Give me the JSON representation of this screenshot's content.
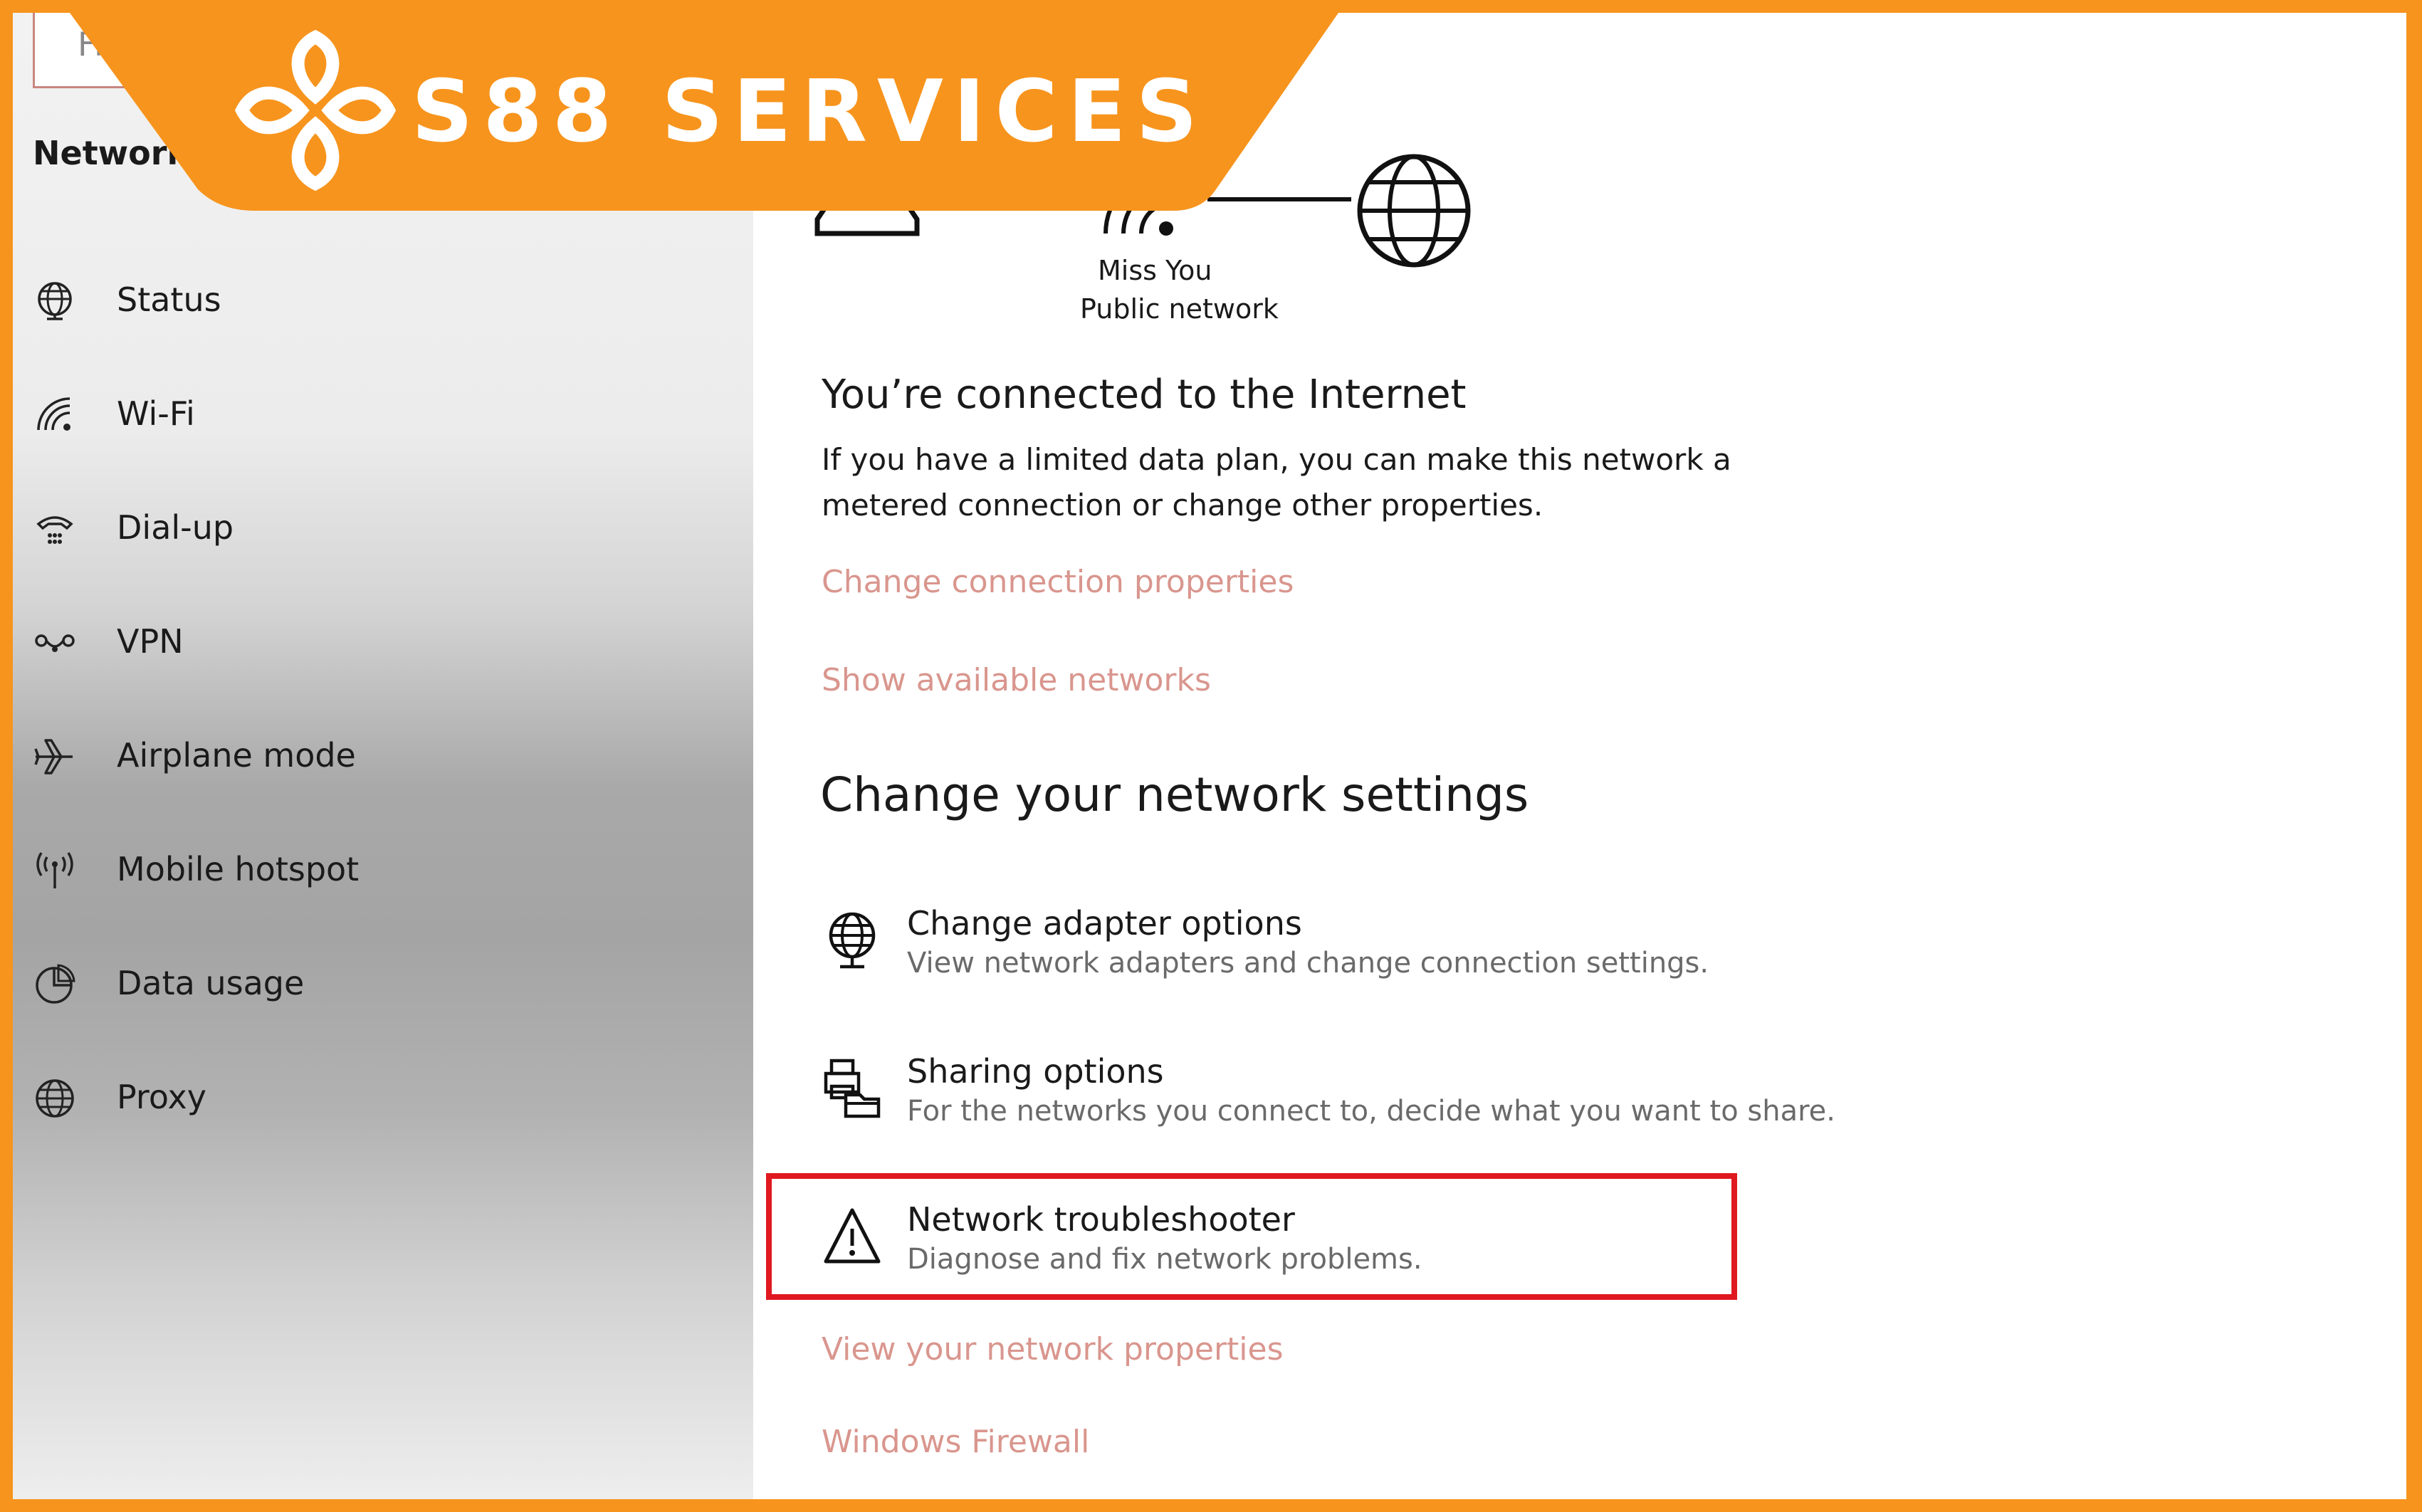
{
  "sidebar": {
    "search_placeholder": "Fi",
    "title": "Network &",
    "items": [
      {
        "label": "Status",
        "icon": "globe-icon"
      },
      {
        "label": "Wi-Fi",
        "icon": "wifi-icon"
      },
      {
        "label": "Dial-up",
        "icon": "dialup-icon"
      },
      {
        "label": "VPN",
        "icon": "vpn-icon"
      },
      {
        "label": "Airplane mode",
        "icon": "airplane-icon"
      },
      {
        "label": "Mobile hotspot",
        "icon": "hotspot-icon"
      },
      {
        "label": "Data usage",
        "icon": "pie-chart-icon"
      },
      {
        "label": "Proxy",
        "icon": "globe-icon"
      }
    ]
  },
  "network": {
    "name": "Miss You",
    "type": "Public network"
  },
  "status": {
    "heading": "You’re connected to the Internet",
    "description_line1": "If you have a limited data plan, you can make this network a",
    "description_line2": "metered connection or change other properties.",
    "link_change_properties": "Change connection properties",
    "link_show_networks": "Show available networks"
  },
  "settings": {
    "heading": "Change your network settings",
    "items": [
      {
        "title": "Change adapter options",
        "desc": "View network adapters and change connection settings.",
        "icon": "adapter-icon"
      },
      {
        "title": "Sharing options",
        "desc": "For the networks you connect to, decide what you want to share.",
        "icon": "sharing-icon"
      },
      {
        "title": "Network troubleshooter",
        "desc": "Diagnose and fix network problems.",
        "icon": "warning-icon"
      }
    ],
    "link_view_properties": "View your network properties",
    "link_firewall": "Windows Firewall"
  },
  "banner": {
    "brand": "S88 SERVICES",
    "color": "#f7941d"
  },
  "colors": {
    "link": "#d9968e",
    "highlight": "#e0181f",
    "frame": "#f7941d"
  }
}
